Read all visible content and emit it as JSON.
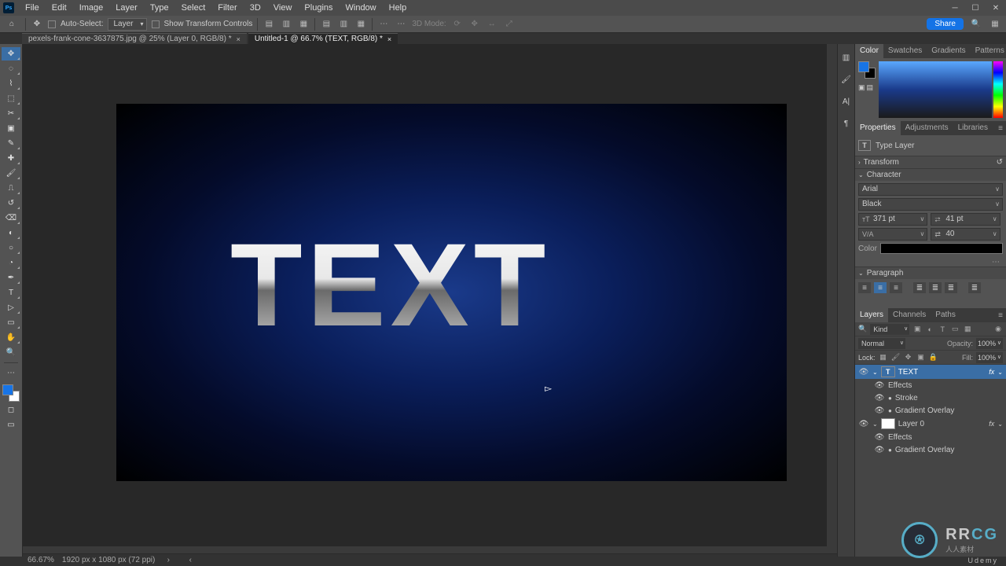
{
  "menubar": {
    "app_icon": "Ps",
    "items": [
      "File",
      "Edit",
      "Image",
      "Layer",
      "Type",
      "Select",
      "Filter",
      "3D",
      "View",
      "Plugins",
      "Window",
      "Help"
    ]
  },
  "optionsbar": {
    "auto_select": "Auto-Select:",
    "target": "Layer",
    "show_transform": "Show Transform Controls",
    "mode3d": "3D Mode:",
    "share": "Share"
  },
  "doctabs": [
    {
      "label": "pexels-frank-cone-3637875.jpg @ 25% (Layer 0, RGB/8) *",
      "active": false
    },
    {
      "label": "Untitled-1 @ 66.7% (TEXT, RGB/8) *",
      "active": true
    }
  ],
  "canvas": {
    "text": "TEXT"
  },
  "color_panel": {
    "tabs": [
      "Color",
      "Swatches",
      "Gradients",
      "Patterns"
    ],
    "active": 0
  },
  "properties_panel": {
    "tabs": [
      "Properties",
      "Adjustments",
      "Libraries"
    ],
    "active": 0,
    "type_layer": "Type Layer",
    "sections": {
      "transform": "Transform",
      "character": "Character",
      "paragraph": "Paragraph"
    },
    "font_family": "Arial",
    "font_style": "Black",
    "font_size": "371 pt",
    "leading": "41 pt",
    "metrics": "",
    "tracking": "40",
    "color_label": "Color"
  },
  "layers_panel": {
    "tabs": [
      "Layers",
      "Channels",
      "Paths"
    ],
    "active": 0,
    "kind": "Kind",
    "blend": "Normal",
    "opacity_label": "Opacity:",
    "opacity": "100%",
    "lock_label": "Lock:",
    "fill_label": "Fill:",
    "fill": "100%",
    "layers": [
      {
        "name": "TEXT",
        "selected": true,
        "visible": true,
        "type": "T",
        "fx": "fx",
        "effects_label": "Effects",
        "effects": [
          "Stroke",
          "Gradient Overlay"
        ]
      },
      {
        "name": "Layer 0",
        "selected": false,
        "visible": true,
        "type": "img",
        "fx": "fx",
        "effects_label": "Effects",
        "effects": [
          "Gradient Overlay"
        ]
      }
    ]
  },
  "statusbar": {
    "zoom": "66.67%",
    "doc_info": "1920 px x 1080 px (72 ppi)"
  },
  "watermark": {
    "brand1": "RR",
    "brand2": "CG",
    "tagline": "人人素材",
    "corner": "Udemy"
  }
}
